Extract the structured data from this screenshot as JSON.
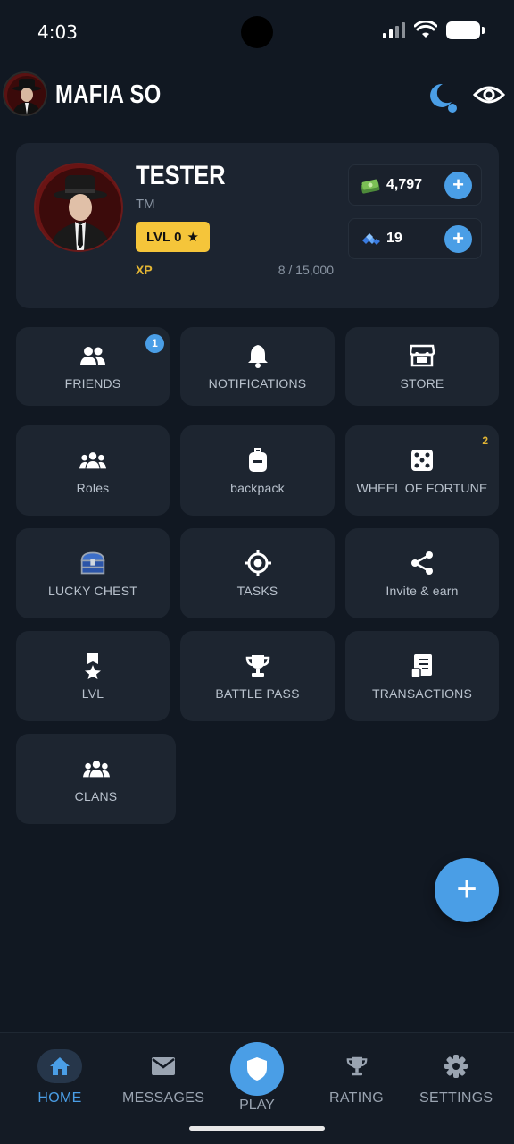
{
  "status_bar": {
    "time": "4:03"
  },
  "header": {
    "title": "MAFIA SO",
    "moon_icon": "moon-icon",
    "eye_icon": "eye-icon"
  },
  "profile": {
    "name": "TESTER",
    "subtitle": "TM",
    "level": "LVL 0",
    "xp_label": "XP",
    "xp_value": "8 / 15,000",
    "cash": "4,797",
    "gems": "19"
  },
  "tiles": [
    {
      "label": "FRIENDS",
      "icon": "users-icon",
      "badge": "1"
    },
    {
      "label": "NOTIFICATIONS",
      "icon": "bell-icon"
    },
    {
      "label": "STORE",
      "icon": "store-icon"
    },
    {
      "label": "Roles",
      "icon": "group-icon"
    },
    {
      "label": "backpack",
      "icon": "backpack-icon"
    },
    {
      "label": "WHEEL OF FORTUNE",
      "icon": "dice-icon",
      "count": "2"
    },
    {
      "label": "LUCKY CHEST",
      "icon": "chest-icon"
    },
    {
      "label": "TASKS",
      "icon": "target-icon"
    },
    {
      "label": "Invite & earn",
      "icon": "share-icon"
    },
    {
      "label": "LVL",
      "icon": "medal-icon"
    },
    {
      "label": "BATTLE PASS",
      "icon": "trophy-icon"
    },
    {
      "label": "TRANSACTIONS",
      "icon": "receipt-icon"
    },
    {
      "label": "CLANS",
      "icon": "group-icon"
    }
  ],
  "fab": {
    "label": "+"
  },
  "nav": {
    "home": "HOME",
    "messages": "MESSAGES",
    "play": "PLAY",
    "rating": "RATING",
    "settings": "SETTINGS"
  },
  "colors": {
    "accent": "#4a9ee6",
    "gold": "#f5c53a",
    "background": "#111822",
    "card": "#1d2530"
  }
}
